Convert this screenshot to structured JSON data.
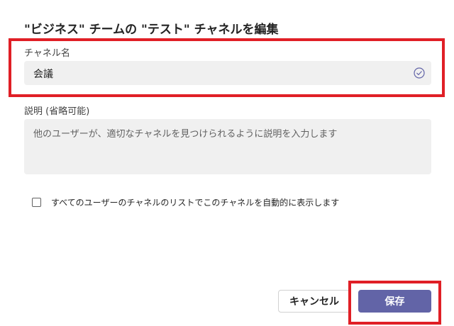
{
  "dialog": {
    "title": "\"ビジネス\" チームの \"テスト\" チャネルを編集"
  },
  "channel_name": {
    "label": "チャネル名",
    "value": "会議",
    "valid_icon": "check-circle-icon"
  },
  "description": {
    "label": "説明 (省略可能)",
    "placeholder": "他のユーザーが、適切なチャネルを見つけられるように説明を入力します"
  },
  "auto_show": {
    "label": "すべてのユーザーのチャネルのリストでこのチャネルを自動的に表示します",
    "checked": false
  },
  "buttons": {
    "cancel_label": "キャンセル",
    "save_label": "保存"
  },
  "colors": {
    "accent": "#6264a7",
    "highlight": "#e01f26",
    "field_bg": "#f0f0f0"
  }
}
